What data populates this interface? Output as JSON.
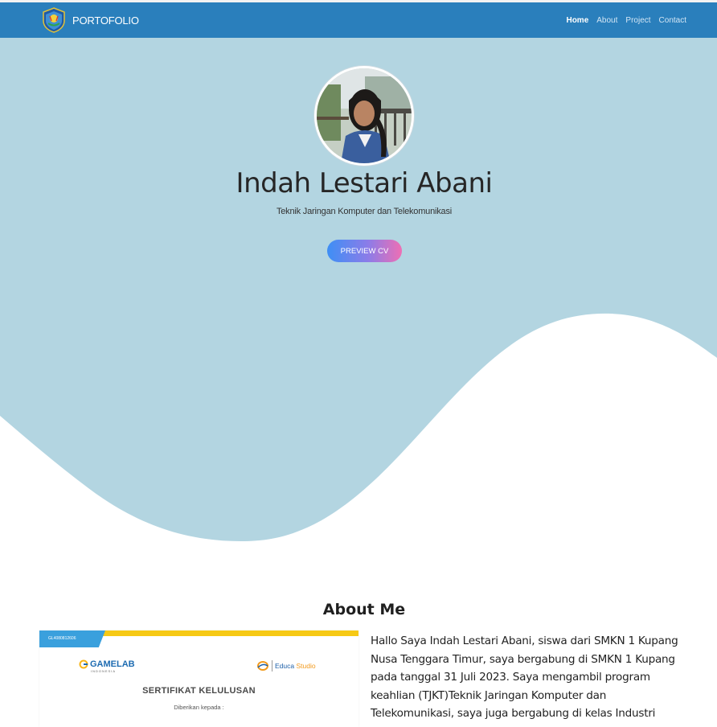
{
  "navbar": {
    "brand": "PORTOFOLIO",
    "links": [
      {
        "label": "Home",
        "active": true
      },
      {
        "label": "About",
        "active": false
      },
      {
        "label": "Project",
        "active": false
      },
      {
        "label": "Contact",
        "active": false
      }
    ],
    "background_color": "#2a7fbc"
  },
  "hero": {
    "name": "Indah Lestari Abani",
    "subtitle": "Teknik Jaringan Komputer dan Telekomunikasi",
    "cv_button": "PREVIEW CV",
    "background_color": "#b3d5e1",
    "profile_photo_icon": "profile-photo"
  },
  "about": {
    "title": "About Me",
    "text": "Hallo Saya Indah Lestari Abani, siswa dari SMKN 1 Kupang Nusa Tenggara Timur, saya bergabung di SMKN 1 Kupang pada tanggal 31 Juli 2023. Saya mengambil program keahlian (TJKT)Teknik Jaringan Komputer dan Telekomunikasi, saya juga bergabung di kelas Industri",
    "certificate": {
      "id": "GL4080812606",
      "gamelab": "GAMELAB",
      "gamelab_sub": "INDONESIA",
      "educa_left": "Educa",
      "educa_right": "Studio",
      "title": "SERTIFIKAT KELULUSAN",
      "given_to": "Diberikan kepada :"
    }
  }
}
